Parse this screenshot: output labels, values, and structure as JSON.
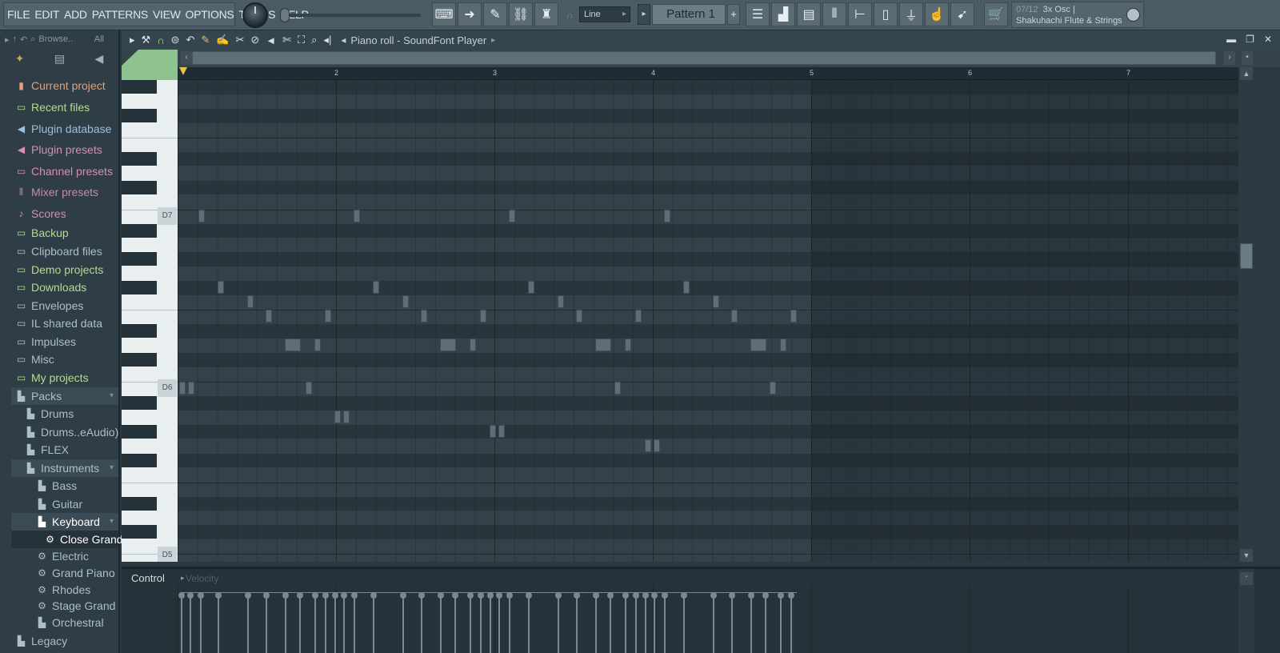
{
  "menu": [
    "FILE",
    "EDIT",
    "ADD",
    "PATTERNS",
    "VIEW",
    "OPTIONS",
    "TOOLS",
    "HELP"
  ],
  "toolbar": {
    "snap_value": "Line",
    "pattern_name": "Pattern 1",
    "pattern_add_label": "+"
  },
  "hint": {
    "counter": "07/12",
    "line1": "3x Osc |",
    "line2": "Shakuhachi Flute & Strings"
  },
  "browser": {
    "browse_label": "Browse..",
    "filter_label": "All",
    "items": [
      {
        "label": "Current project",
        "icon": "project-icon",
        "color": "#e4a07a"
      },
      {
        "label": "Recent files",
        "icon": "recent-folder-icon",
        "color": "#b7dc8d"
      },
      {
        "label": "Plugin database",
        "icon": "plugin-icon",
        "color": "#9dbfe3"
      },
      {
        "label": "Plugin presets",
        "icon": "plugin-preset-icon",
        "color": "#d58fb6"
      },
      {
        "label": "Channel presets",
        "icon": "channel-icon",
        "color": "#d58fb6"
      },
      {
        "label": "Mixer presets",
        "icon": "mixer-icon",
        "color": "#c28ab4"
      },
      {
        "label": "Scores",
        "icon": "note-icon",
        "color": "#d58fb6"
      },
      {
        "label": "Backup",
        "icon": "backup-folder-icon",
        "color": "#b7dc8d"
      },
      {
        "label": "Clipboard files",
        "icon": "folder-icon",
        "color": "#aebfca"
      },
      {
        "label": "Demo projects",
        "icon": "folder-icon",
        "color": "#b7dc8d"
      },
      {
        "label": "Downloads",
        "icon": "folder-icon",
        "color": "#b7dc8d"
      },
      {
        "label": "Envelopes",
        "icon": "folder-icon",
        "color": "#aebfca"
      },
      {
        "label": "IL shared data",
        "icon": "folder-icon",
        "color": "#aebfca"
      },
      {
        "label": "Impulses",
        "icon": "folder-icon",
        "color": "#aebfca"
      },
      {
        "label": "Misc",
        "icon": "folder-icon",
        "color": "#aebfca"
      },
      {
        "label": "My projects",
        "icon": "folder-icon",
        "color": "#b7dc8d"
      },
      {
        "label": "Packs",
        "icon": "pack-icon",
        "color": "#aebfca"
      },
      {
        "label": "Drums",
        "icon": "pack-icon",
        "color": "#aebfca"
      },
      {
        "label": "Drums..eAudio)",
        "icon": "pack-icon",
        "color": "#aebfca"
      },
      {
        "label": "FLEX",
        "icon": "pack-icon",
        "color": "#aebfca"
      },
      {
        "label": "Instruments",
        "icon": "pack-icon",
        "color": "#aebfca"
      },
      {
        "label": "Bass",
        "icon": "pack-icon",
        "color": "#aebfca"
      },
      {
        "label": "Guitar",
        "icon": "pack-icon",
        "color": "#aebfca"
      },
      {
        "label": "Keyboard",
        "icon": "pack-icon",
        "color": "#ffffff"
      },
      {
        "label": "Close Grand",
        "icon": "gear-icon",
        "color": "#ffffff"
      },
      {
        "label": "Electric",
        "icon": "gear-icon",
        "color": "#aebfca"
      },
      {
        "label": "Grand Piano",
        "icon": "gear-icon",
        "color": "#aebfca"
      },
      {
        "label": "Rhodes",
        "icon": "gear-icon",
        "color": "#aebfca"
      },
      {
        "label": "Stage Grand",
        "icon": "gear-icon",
        "color": "#aebfca"
      },
      {
        "label": "Orchestral",
        "icon": "pack-icon",
        "color": "#aebfca"
      },
      {
        "label": "Legacy",
        "icon": "pack-icon",
        "color": "#aebfca"
      }
    ]
  },
  "piano_roll": {
    "title": "Piano roll - SoundFont Player",
    "bar_numbers": [
      "2",
      "3",
      "4",
      "5",
      "6",
      "7"
    ],
    "key_labels": [
      "D7",
      "D6",
      "D5"
    ],
    "control_label": "Control",
    "control_param": "Velocity"
  },
  "colors": {
    "note": "#5f6e76",
    "accent_green": "#8ec28f",
    "playhead": "#e8c04a"
  }
}
